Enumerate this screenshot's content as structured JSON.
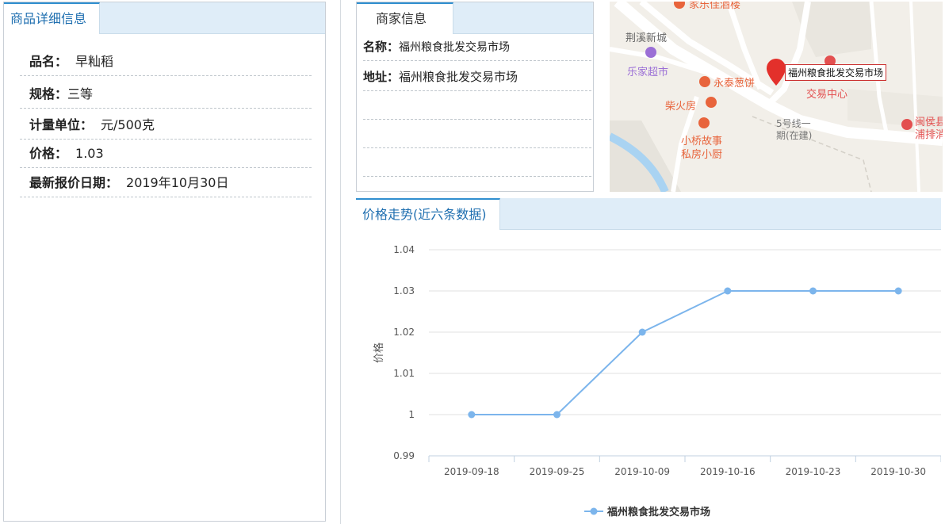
{
  "product": {
    "tab_title": "商品详细信息",
    "rows": [
      {
        "label": "品名：",
        "value": "早籼稻"
      },
      {
        "label": "规格：",
        "value": "三等"
      },
      {
        "label": "计量单位：",
        "value": "元/500克"
      },
      {
        "label": "价格：",
        "value": "1.03"
      },
      {
        "label": "最新报价日期：",
        "value": "2019年10月30日"
      }
    ]
  },
  "merchant": {
    "tab_title": "商家信息",
    "name_label": "名称：",
    "name_value": "福州粮食批发交易市场",
    "addr_label": "地址：",
    "addr_value": "福州粮食批发交易市场"
  },
  "map": {
    "popup": "福州粮食批发交易市场",
    "labels": {
      "top": "家乐佳酒楼",
      "jingxi": "荆溪新城",
      "lejia": "乐家超市",
      "yongtai": "永泰葱饼",
      "chaihuo": "柴火房",
      "xiaoqiao1": "小桥故事",
      "xiaoqiao2": "私房小厨",
      "jiaoyi": "交易中心",
      "line5a": "5号线一",
      "line5b": "期(在建)",
      "minhou1": "闽侯县",
      "minhou2": "浦排消"
    },
    "colors": {
      "poi": "#e8643c",
      "pin": "#e3302b",
      "road": "#ffffff",
      "bg": "#f2efe9"
    }
  },
  "trend": {
    "tab_title": "价格走势(近六条数据)"
  },
  "chart_data": {
    "type": "line",
    "x": [
      "2019-09-18",
      "2019-09-25",
      "2019-10-09",
      "2019-10-16",
      "2019-10-23",
      "2019-10-30"
    ],
    "series": [
      {
        "name": "福州粮食批发交易市场",
        "values": [
          1,
          1,
          1.02,
          1.03,
          1.03,
          1.03
        ]
      }
    ],
    "ylabel": "价格",
    "ylim": [
      0.99,
      1.04
    ],
    "yticks": [
      0.99,
      1,
      1.01,
      1.02,
      1.03,
      1.04
    ],
    "ytick_labels": [
      "0.99",
      "1",
      "1.01",
      "1.02",
      "1.03",
      "1.04"
    ],
    "grid": true,
    "legend": "bottom",
    "color": "#7cb5ec"
  }
}
